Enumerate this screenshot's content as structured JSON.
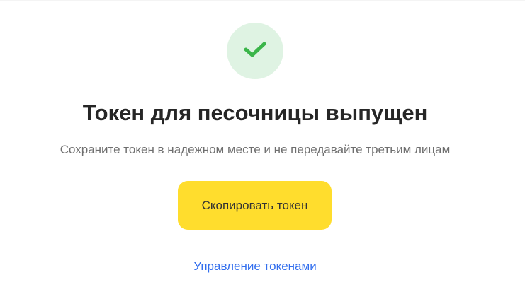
{
  "success": {
    "icon": "check-icon",
    "circle_color": "#dff3e3",
    "check_color": "#3bb54a"
  },
  "title": "Токен для песочницы выпущен",
  "subtitle": "Сохраните токен в надежном месте и не передавайте третьим лицам",
  "copy_button": {
    "label": "Скопировать токен",
    "color": "#ffdd2d"
  },
  "manage_link": {
    "label": "Управление токенами",
    "color": "#336fee"
  }
}
